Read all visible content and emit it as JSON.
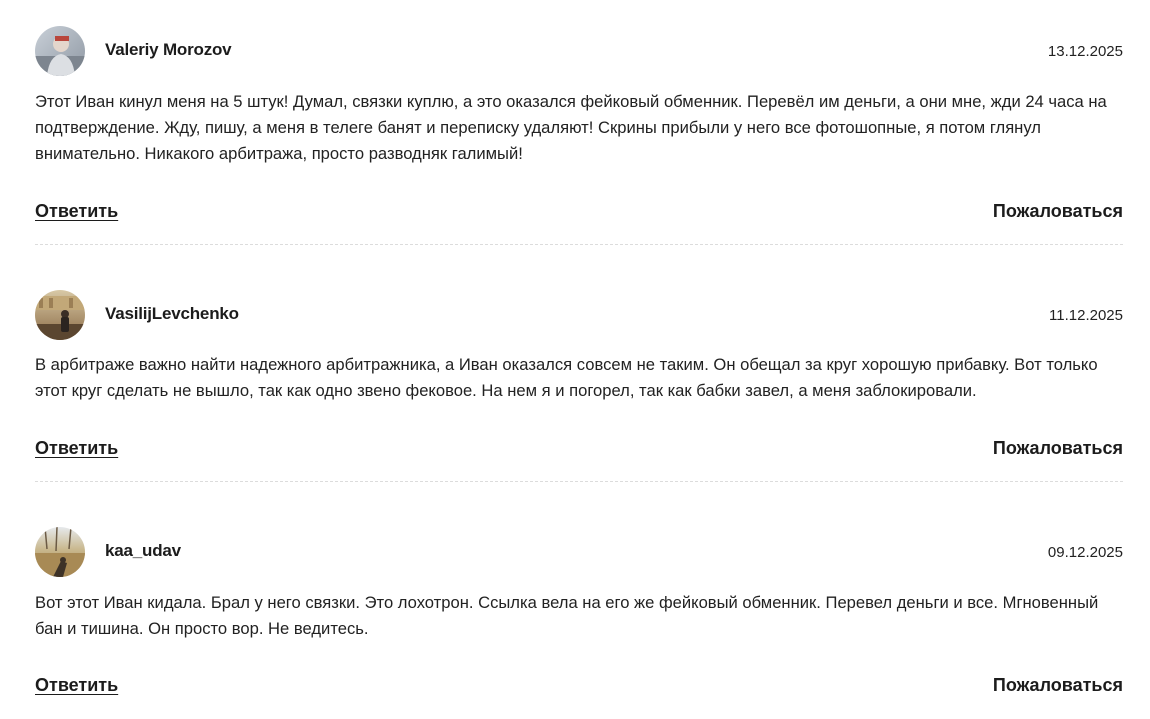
{
  "comments": [
    {
      "author": "Valeriy Morozov",
      "date": "13.12.2025",
      "text": "Этот Иван кинул меня на 5 штук! Думал, связки куплю, а это оказался фейковый обменник. Перевёл им деньги, а они мне, жди 24 часа на подтверждение. Жду, пишу, а меня в телеге банят и переписку удаляют! Скрины прибыли у него все фотошопные, я потом глянул внимательно. Никакого арбитража, просто разводняк галимый!",
      "reply_label": "Ответить",
      "report_label": "Пожаловаться"
    },
    {
      "author": "VasilijLevchenko",
      "date": "11.12.2025",
      "text": "В арбитраже важно найти надежного арбитражника, а Иван оказался совсем не таким. Он обещал за круг хорошую прибавку. Вот только этот круг сделать не вышло, так как одно звено фековое. На нем я и погорел, так как бабки завел, а меня заблокировали.",
      "reply_label": "Ответить",
      "report_label": "Пожаловаться"
    },
    {
      "author": "kaa_udav",
      "date": "09.12.2025",
      "text": "Вот этот Иван кидала. Брал у него связки. Это лохотрон. Ссылка вела на его же фейковый обменник. Перевел деньги и все. Мгновенный бан и тишина. Он просто вор. Не ведитесь.",
      "reply_label": "Ответить",
      "report_label": "Пожаловаться"
    }
  ]
}
